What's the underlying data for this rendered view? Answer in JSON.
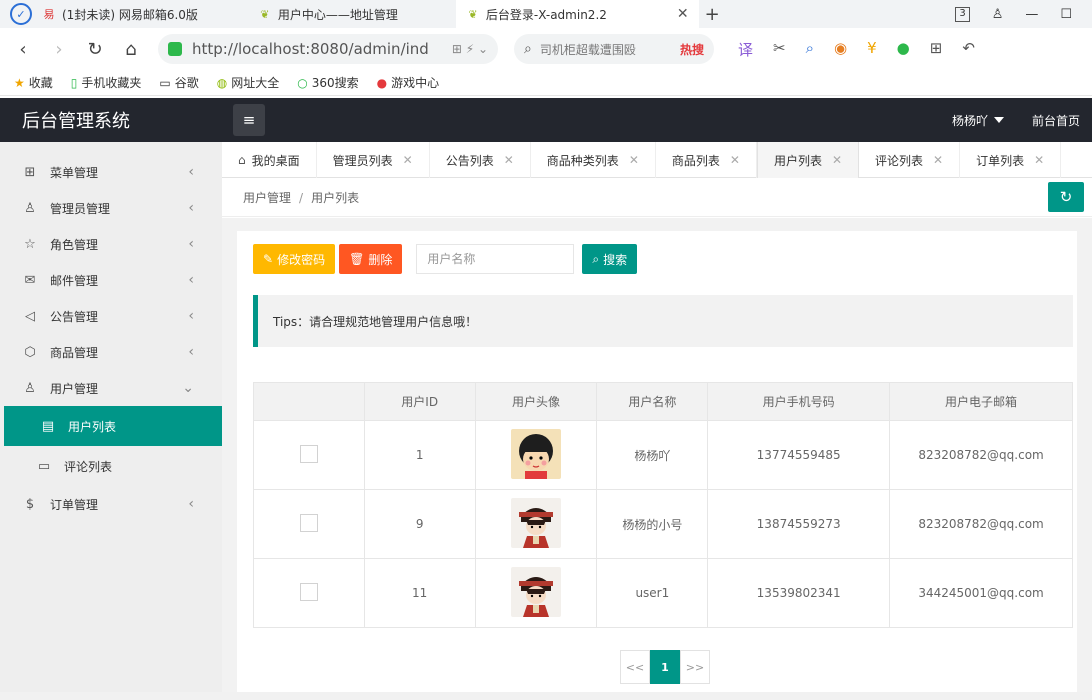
{
  "browser": {
    "tabs": [
      {
        "label": "(1封未读) 网易邮箱6.0版",
        "favicon": "netease-mail-icon"
      },
      {
        "label": "用户中心——地址管理",
        "favicon": "leaf-icon"
      },
      {
        "label": "后台登录-X-admin2.2",
        "favicon": "leaf-icon"
      }
    ],
    "url": "http://localhost:8080/admin/ind",
    "search_placeholder": "司机柜超载遭围殴",
    "search_hot": "热搜",
    "tab_count": "3",
    "bookmarks": [
      {
        "label": "收藏",
        "icon": "star-icon"
      },
      {
        "label": "手机收藏夹",
        "icon": "phone-icon"
      },
      {
        "label": "谷歌",
        "icon": "page-icon"
      },
      {
        "label": "网址大全",
        "icon": "globe-icon"
      },
      {
        "label": "360搜索",
        "icon": "search-360-icon"
      },
      {
        "label": "游戏中心",
        "icon": "game-icon"
      }
    ]
  },
  "app": {
    "title": "后台管理系统",
    "user_name": "杨杨吖",
    "front_link": "前台首页"
  },
  "sidebar": {
    "items": [
      {
        "label": "菜单管理",
        "icon": "grid-icon"
      },
      {
        "label": "管理员管理",
        "icon": "user-icon"
      },
      {
        "label": "角色管理",
        "icon": "star-icon"
      },
      {
        "label": "邮件管理",
        "icon": "mail-icon"
      },
      {
        "label": "公告管理",
        "icon": "speaker-icon"
      },
      {
        "label": "商品管理",
        "icon": "box-icon"
      },
      {
        "label": "用户管理",
        "icon": "user-icon"
      }
    ],
    "subitems": [
      {
        "label": "用户列表",
        "icon": "list-icon"
      },
      {
        "label": "评论列表",
        "icon": "comment-icon"
      }
    ],
    "last_item": {
      "label": "订单管理",
      "icon": "dollar-icon"
    }
  },
  "tabs": [
    {
      "label": "我的桌面"
    },
    {
      "label": "管理员列表"
    },
    {
      "label": "公告列表"
    },
    {
      "label": "商品种类列表"
    },
    {
      "label": "商品列表"
    },
    {
      "label": "用户列表"
    },
    {
      "label": "评论列表"
    },
    {
      "label": "订单列表"
    }
  ],
  "breadcrumb": {
    "parent": "用户管理",
    "current": "用户列表"
  },
  "toolbar": {
    "change_password": "修改密码",
    "delete": "删除",
    "search_placeholder": "用户名称",
    "search": "搜索"
  },
  "tips": "Tips：请合理规范地管理用户信息哦！",
  "table": {
    "headers": [
      "",
      "用户ID",
      "用户头像",
      "用户名称",
      "用户手机号码",
      "用户电子邮箱"
    ],
    "rows": [
      {
        "id": "1",
        "name": "杨杨吖",
        "phone": "13774559485",
        "email": "823208782@qq.com",
        "avatar": "cartoon-girl-avatar"
      },
      {
        "id": "9",
        "name": "杨杨的小号",
        "phone": "13874559273",
        "email": "823208782@qq.com",
        "avatar": "anime-avatar"
      },
      {
        "id": "11",
        "name": "user1",
        "phone": "13539802341",
        "email": "344245001@qq.com",
        "avatar": "anime-avatar"
      }
    ]
  },
  "pager": {
    "prev": "<<",
    "current": "1",
    "next": ">>"
  },
  "colors": {
    "accent": "#009688",
    "warn": "#ffb800",
    "danger": "#ff5722",
    "header": "#23262e"
  }
}
